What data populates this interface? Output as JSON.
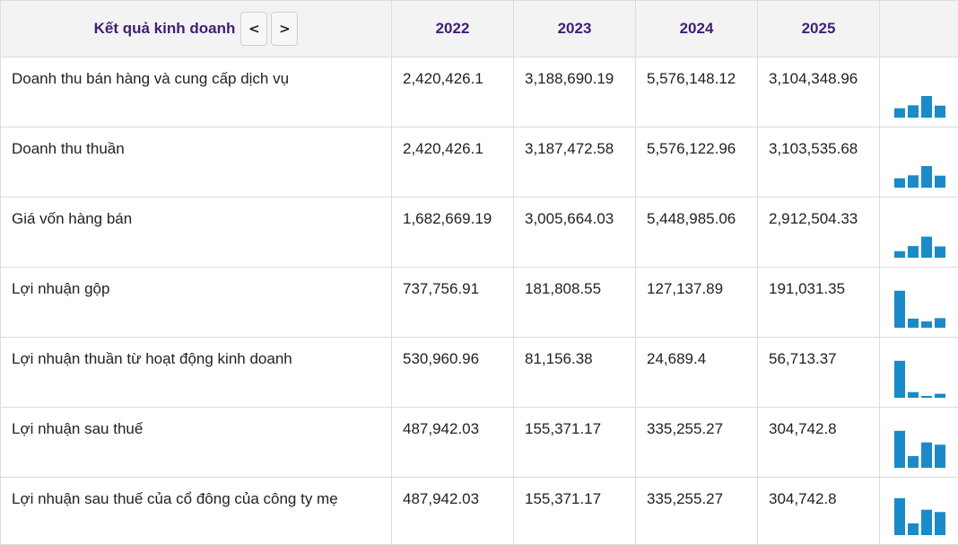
{
  "header": {
    "title": "Kết quả kinh doanh",
    "prev_label": "<",
    "next_label": ">",
    "years": [
      "2022",
      "2023",
      "2024",
      "2025"
    ]
  },
  "colors": {
    "accent": "#3f1f78",
    "bar": "#1a8ac9",
    "header_bg": "#f3f3f3"
  },
  "rows": [
    {
      "label": "Doanh thu bán hàng và cung cấp dịch vụ",
      "values": [
        "2,420,426.1",
        "3,188,690.19",
        "5,576,148.12",
        "3,104,348.96"
      ],
      "numbers": [
        2420426.1,
        3188690.19,
        5576148.12,
        3104348.96
      ]
    },
    {
      "label": "Doanh thu thuần",
      "values": [
        "2,420,426.1",
        "3,187,472.58",
        "5,576,122.96",
        "3,103,535.68"
      ],
      "numbers": [
        2420426.1,
        3187472.58,
        5576122.96,
        3103535.68
      ]
    },
    {
      "label": "Giá vốn hàng bán",
      "values": [
        "1,682,669.19",
        "3,005,664.03",
        "5,448,985.06",
        "2,912,504.33"
      ],
      "numbers": [
        1682669.19,
        3005664.03,
        5448985.06,
        2912504.33
      ]
    },
    {
      "label": "Lợi nhuận gộp",
      "values": [
        "737,756.91",
        "181,808.55",
        "127,137.89",
        "191,031.35"
      ],
      "numbers": [
        737756.91,
        181808.55,
        127137.89,
        191031.35
      ]
    },
    {
      "label": "Lợi nhuận thuần từ hoạt động kinh doanh",
      "values": [
        "530,960.96",
        "81,156.38",
        "24,689.4",
        "56,713.37"
      ],
      "numbers": [
        530960.96,
        81156.38,
        24689.4,
        56713.37
      ]
    },
    {
      "label": "Lợi nhuận sau thuế",
      "values": [
        "487,942.03",
        "155,371.17",
        "335,255.27",
        "304,742.8"
      ],
      "numbers": [
        487942.03,
        155371.17,
        335255.27,
        304742.8
      ]
    },
    {
      "label": "Lợi nhuận sau thuế của cổ đông của công ty mẹ",
      "values": [
        "487,942.03",
        "155,371.17",
        "335,255.27",
        "304,742.8"
      ],
      "numbers": [
        487942.03,
        155371.17,
        335255.27,
        304742.8
      ]
    }
  ]
}
